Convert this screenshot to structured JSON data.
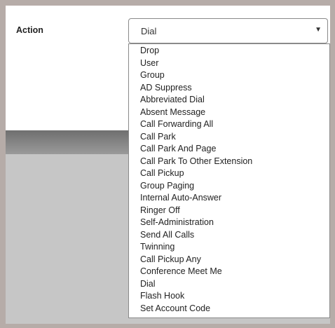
{
  "form": {
    "action_label": "Action",
    "action_select": {
      "value": "Dial",
      "caret_icon": "caret-down-icon",
      "options": [
        "Drop",
        "User",
        "Group",
        "AD Suppress",
        "Abbreviated Dial",
        "Absent Message",
        "Call Forwarding All",
        "Call Park",
        "Call Park And Page",
        "Call Park To Other Extension",
        "Call Pickup",
        "Group Paging",
        "Internal Auto-Answer",
        "Ringer Off",
        "Self-Administration",
        "Send All Calls",
        "Twinning",
        "Call Pickup Any",
        "Conference Meet Me",
        "Dial",
        "Flash Hook",
        "Set Account Code"
      ]
    }
  }
}
